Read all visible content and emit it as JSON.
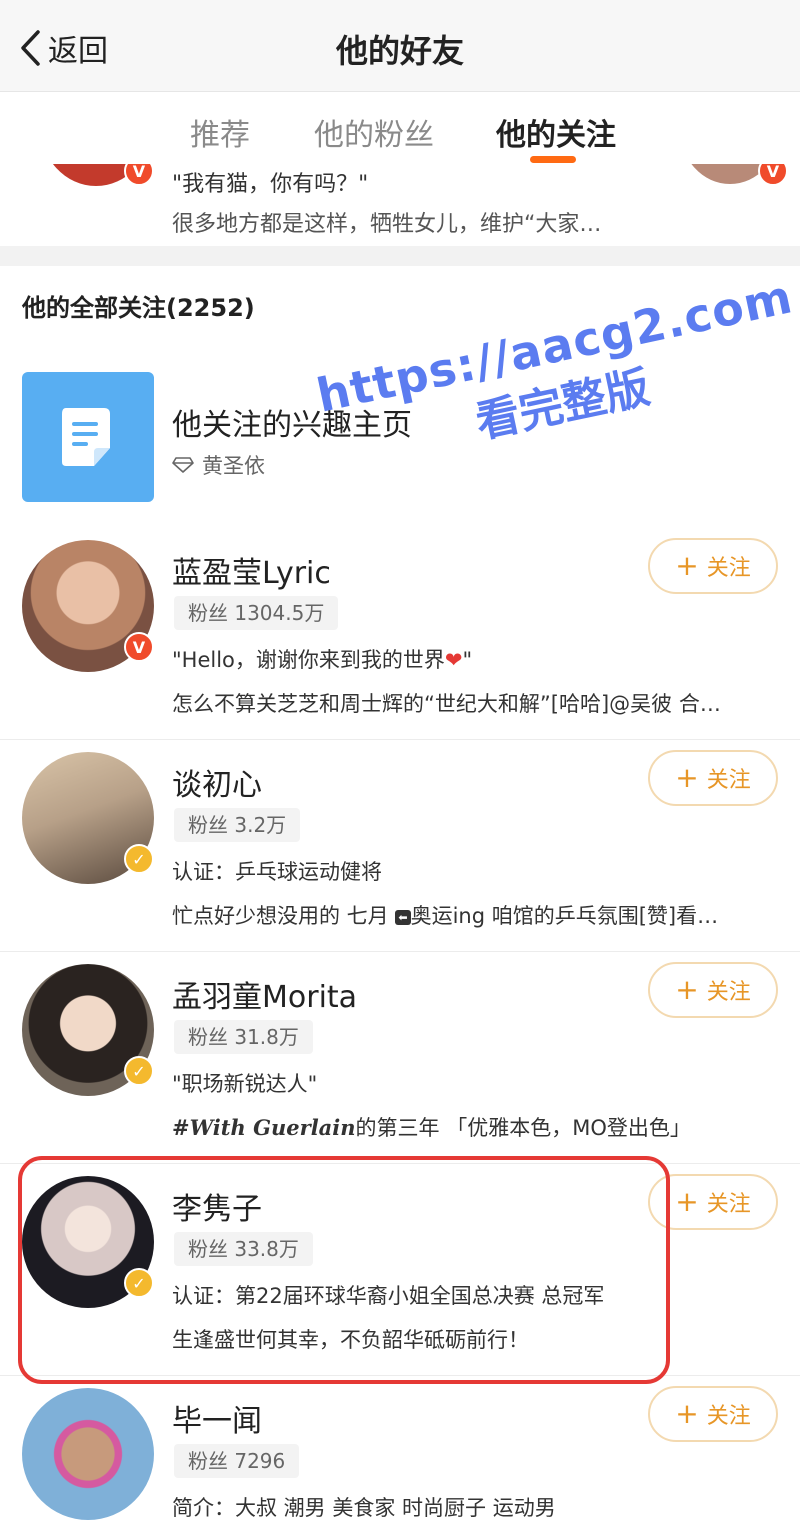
{
  "header": {
    "back_label": "返回",
    "title": "他的好友"
  },
  "tabs": [
    {
      "label": "推荐"
    },
    {
      "label": "他的粉丝"
    },
    {
      "label": "他的关注"
    }
  ],
  "active_tab": "他的关注",
  "partial_card": {
    "line1": "\"我有猫，你有吗？\"",
    "line2": "很多地方都是这样，牺牲女儿，维护“大家…"
  },
  "section_title": "他的全部关注(2252)",
  "interest_page": {
    "title": "他关注的兴趣主页",
    "subtitle": "黄圣依"
  },
  "follow_label": "关注",
  "users": [
    {
      "name": "蓝盈莹Lyric",
      "fans": "粉丝 1304.5万",
      "desc1_a": "\"Hello，谢谢你来到我的世界",
      "desc1_b": "\"",
      "desc2": "怎么不算关芝芝和周士辉的“世纪大和解”[哈哈]@吴彼 合…",
      "badge": "red"
    },
    {
      "name": "谈初心",
      "fans": "粉丝 3.2万",
      "desc1": "认证：乒乓球运动健将",
      "desc2_a": "忙点好少想没用的 七月",
      "desc2_b": "奥运ing 咱馆的乒乓氛围[赞]看…",
      "badge": "gold"
    },
    {
      "name": "孟羽童Morita",
      "fans": "粉丝 31.8万",
      "desc1": "\"职场新锐达人\"",
      "desc2_tag": "#With Guerlain",
      "desc2_rest": "的第三年 「优雅本色，MO登出色」",
      "badge": "gold"
    },
    {
      "name": "李隽子",
      "fans": "粉丝 33.8万",
      "desc1": "认证：第22届环球华裔小姐全国总决赛 总冠军",
      "desc2": "生逢盛世何其幸，不负韶华砥砺前行！",
      "badge": "gold"
    },
    {
      "name": "毕一闻",
      "fans": "粉丝 7296",
      "desc1": "简介：大叔 潮男 美食家 时尚厨子 运动男",
      "badge": "none"
    }
  ],
  "watermark": {
    "line1": "https://aacg2.com",
    "line2": "看完整版"
  },
  "colors": {
    "accent": "#ff6a13",
    "follow": "#e79627",
    "verified_red": "#f04b2b",
    "verified_gold": "#f4b92e",
    "highlight": "#e53935"
  }
}
